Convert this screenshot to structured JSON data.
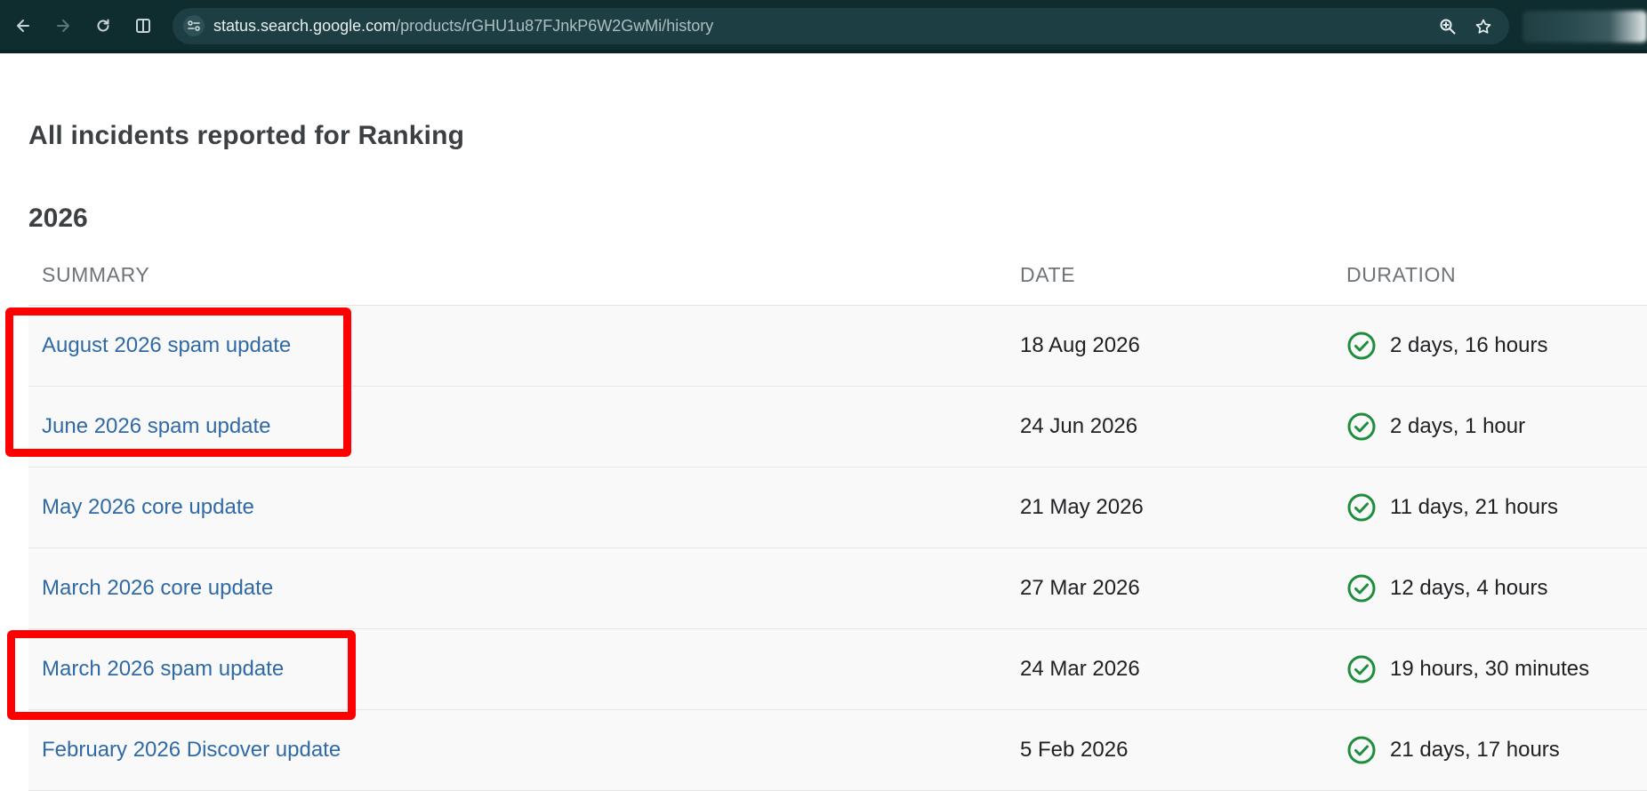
{
  "browser": {
    "url_host": "status.search.google.com",
    "url_path": "/products/rGHU1u87FJnkP6W2GwMi/history",
    "icons": [
      "back-icon",
      "forward-icon",
      "reload-icon",
      "split-view-icon",
      "site-info-icon",
      "zoom-icon",
      "bookmark-star-icon"
    ]
  },
  "page": {
    "title": "All incidents reported for Ranking",
    "year": "2026"
  },
  "table": {
    "headers": {
      "summary": "SUMMARY",
      "date": "DATE",
      "duration": "DURATION"
    },
    "rows": [
      {
        "summary": "August 2026 spam update",
        "date": "18 Aug 2026",
        "duration": "2 days, 16 hours",
        "status": "resolved",
        "highlighted": true
      },
      {
        "summary": "June 2026 spam update",
        "date": "24 Jun 2026",
        "duration": "2 days, 1 hour",
        "status": "resolved",
        "highlighted": true
      },
      {
        "summary": "May 2026 core update",
        "date": "21 May 2026",
        "duration": "11 days, 21 hours",
        "status": "resolved",
        "highlighted": false
      },
      {
        "summary": "March 2026 core update",
        "date": "27 Mar 2026",
        "duration": "12 days, 4 hours",
        "status": "resolved",
        "highlighted": false
      },
      {
        "summary": "March 2026 spam update",
        "date": "24 Mar 2026",
        "duration": "19 hours, 30 minutes",
        "status": "resolved",
        "highlighted": true
      },
      {
        "summary": "February 2026 Discover update",
        "date": "5 Feb 2026",
        "duration": "21 days, 17 hours",
        "status": "resolved",
        "highlighted": false
      }
    ]
  },
  "colors": {
    "link": "#2f6aa6",
    "status_ok": "#1e8e3e",
    "highlight": "#ff0000",
    "chrome": "#0f2c2f"
  }
}
